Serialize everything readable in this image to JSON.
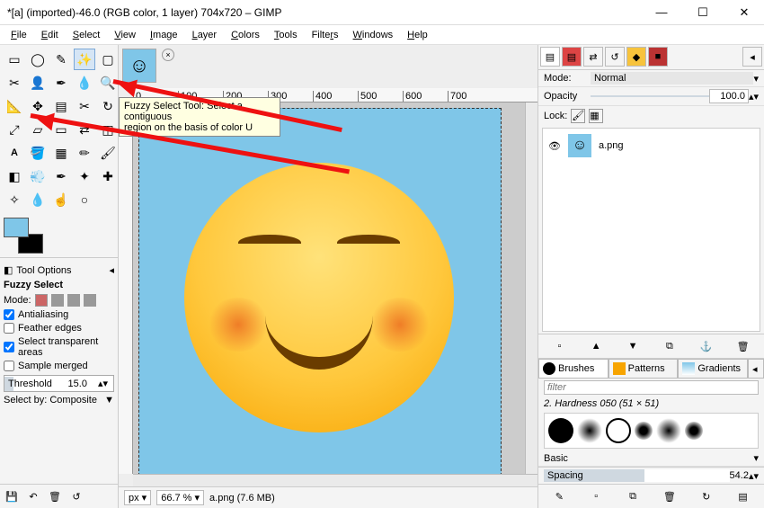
{
  "title": "*[a] (imported)-46.0 (RGB color, 1 layer) 704x720 – GIMP",
  "menus": [
    "File",
    "Edit",
    "Select",
    "View",
    "Image",
    "Layer",
    "Colors",
    "Tools",
    "Filters",
    "Windows",
    "Help"
  ],
  "tooltip": {
    "line1": "Fuzzy Select Tool: Select a contiguous",
    "line2": "region on the basis of color  U"
  },
  "tool_options": {
    "panel_label": "Tool Options",
    "title": "Fuzzy Select",
    "mode_label": "Mode:",
    "antialias": "Antialiasing",
    "feather": "Feather edges",
    "transparent": "Select transparent areas",
    "sample_merged": "Sample merged",
    "threshold_label": "Threshold",
    "threshold_value": "15.0",
    "select_by": "Select by: Composite"
  },
  "ruler_marks": [
    "0",
    "100",
    "200",
    "300",
    "400",
    "500",
    "600",
    "700"
  ],
  "status": {
    "unit": "px",
    "zoom": "66.7 %",
    "file": "a.png (7.6 MB)"
  },
  "right": {
    "mode_label": "Mode:",
    "mode_value": "Normal",
    "opacity_label": "Opacity",
    "opacity_value": "100.0",
    "lock_label": "Lock:",
    "layer_name": "a.png",
    "brush_tabs": [
      "Brushes",
      "Patterns",
      "Gradients"
    ],
    "filter_placeholder": "filter",
    "brush_name": "2. Hardness 050 (51 × 51)",
    "basic_label": "Basic",
    "spacing_label": "Spacing",
    "spacing_value": "54.2"
  }
}
